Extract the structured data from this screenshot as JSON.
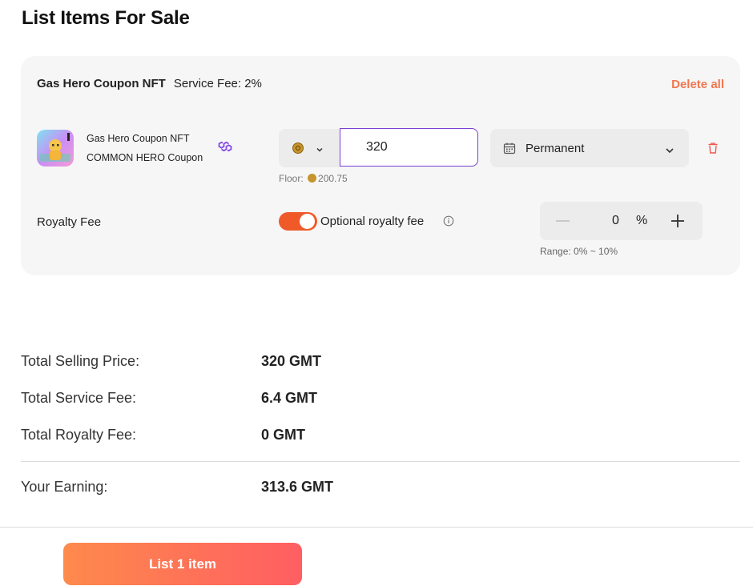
{
  "page": {
    "title": "List Items For Sale"
  },
  "card": {
    "collection_name": "Gas Hero Coupon NFT",
    "service_fee": "Service Fee: 2%",
    "delete_all": "Delete all",
    "item": {
      "name_line1": "Gas Hero Coupon NFT",
      "name_line2": "COMMON HERO Coupon",
      "chain_icon": "polygon-icon",
      "price_value": "320",
      "floor_label": "Floor:",
      "floor_value": "200.75",
      "duration": "Permanent"
    },
    "royalty": {
      "label": "Royalty Fee",
      "toggle_on": true,
      "toggle_label": "Optional royalty fee",
      "value": "0",
      "unit": "%",
      "range": "Range: 0% ~ 10%"
    }
  },
  "summary": {
    "rows": [
      {
        "label": "Total Selling Price:",
        "value": "320 GMT"
      },
      {
        "label": "Total Service Fee:",
        "value": "6.4 GMT"
      },
      {
        "label": "Total Royalty Fee:",
        "value": "0 GMT"
      },
      {
        "label": "Your Earning:",
        "value": "313.6 GMT"
      }
    ]
  },
  "actions": {
    "list_button": "List 1 item"
  },
  "colors": {
    "accent": "#f05a28",
    "delete": "#f0774f",
    "input_border": "#7b3fd3",
    "chain": "#8247e5"
  }
}
